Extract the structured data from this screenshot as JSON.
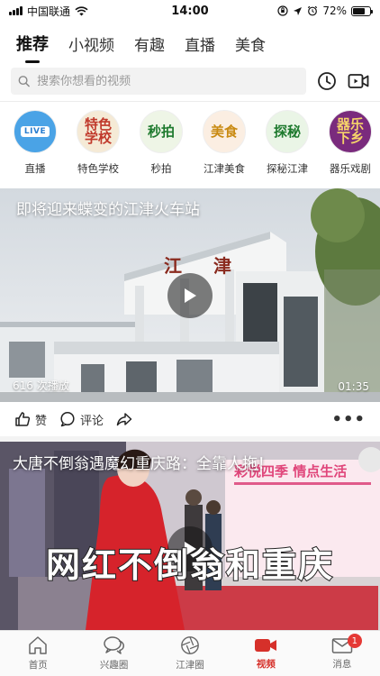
{
  "status_bar": {
    "carrier": "中国联通",
    "time": "14:00",
    "battery_percent": "72%",
    "battery_level": 0.72
  },
  "top_tabs": [
    {
      "label": "推荐",
      "active": true
    },
    {
      "label": "小视频",
      "active": false
    },
    {
      "label": "有趣",
      "active": false
    },
    {
      "label": "直播",
      "active": false
    },
    {
      "label": "美食",
      "active": false
    }
  ],
  "search": {
    "placeholder": "搜索你想看的视频"
  },
  "channels": [
    {
      "label": "直播",
      "icon": "live-icon",
      "badge_text": "LIVE"
    },
    {
      "label": "特色学校",
      "icon_text": "特色\n学校"
    },
    {
      "label": "秒拍",
      "icon_text": "秒拍"
    },
    {
      "label": "江津美食",
      "icon_text": "美食"
    },
    {
      "label": "探秘江津",
      "icon_text": "探秘"
    },
    {
      "label": "器乐戏剧",
      "icon_text": "器乐下乡"
    }
  ],
  "video1": {
    "title": "即将迎来蝶变的江津火车站",
    "views": "616 次播放",
    "duration": "01:35",
    "sign_text": "江 津"
  },
  "actions": {
    "like_label": "赞",
    "comment_label": "评论",
    "more_label": "•••"
  },
  "video2": {
    "title": "大唐不倒翁遇魔幻重庆路：全靠人拖！",
    "caption": "网红不倒翁和重庆",
    "billboard_text": "彩悦四季  情点生活"
  },
  "bottom_nav": [
    {
      "label": "首页",
      "icon": "home-icon",
      "active": false
    },
    {
      "label": "兴趣圈",
      "icon": "chat-bubbles-icon",
      "active": false
    },
    {
      "label": "江津圈",
      "icon": "aperture-icon",
      "active": false
    },
    {
      "label": "视频",
      "icon": "video-camera-icon",
      "active": true
    },
    {
      "label": "消息",
      "icon": "mail-icon",
      "active": false,
      "badge": "1"
    }
  ],
  "colors": {
    "accent": "#d6302a",
    "badge": "#e53935"
  }
}
